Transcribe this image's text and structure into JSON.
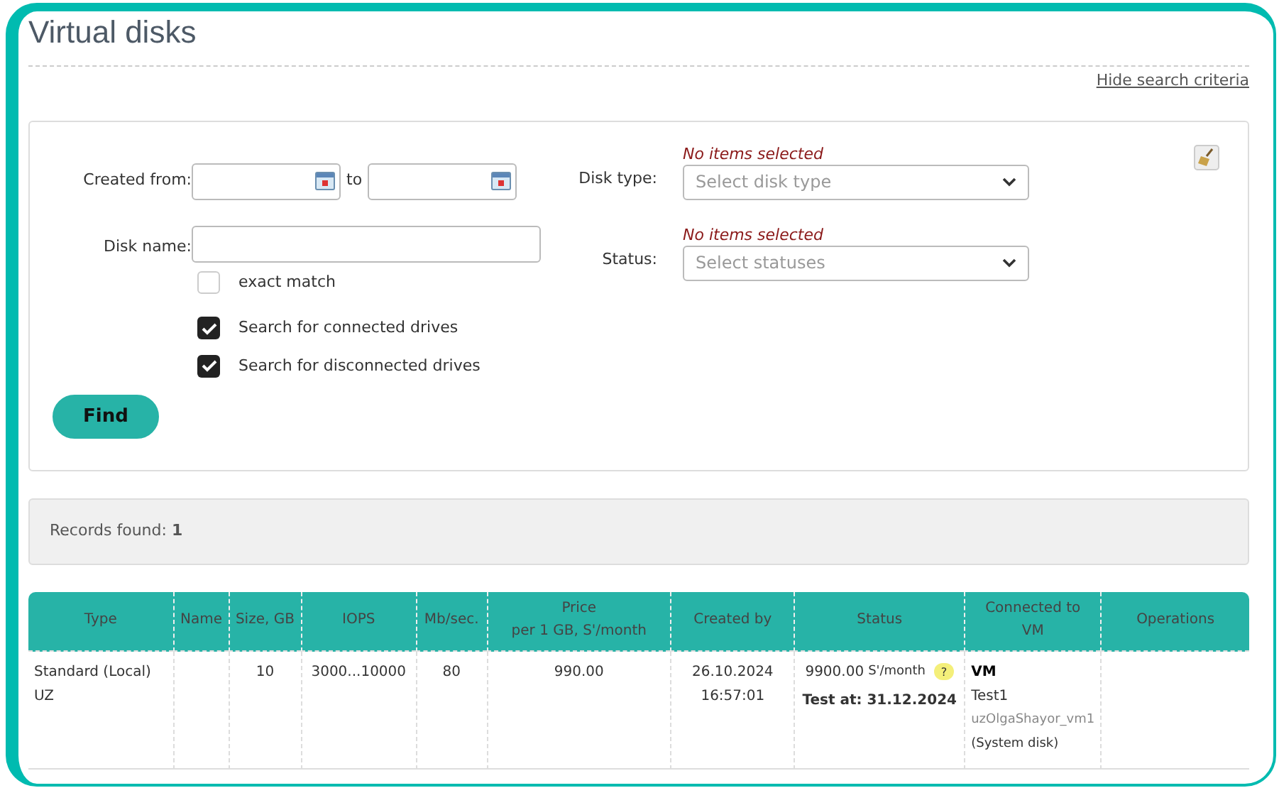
{
  "title": "Virtual disks",
  "hide_link": "Hide search criteria",
  "filters": {
    "created_from": {
      "label": "Created from:",
      "to_label": "to"
    },
    "disk_name": {
      "label": "Disk name:",
      "exact_match": {
        "label": "exact match",
        "checked": false
      }
    },
    "disk_type": {
      "label": "Disk type:",
      "note": "No items selected",
      "placeholder": "Select disk type"
    },
    "status": {
      "label": "Status:",
      "note": "No items selected",
      "placeholder": "Select statuses"
    },
    "checkboxes": [
      {
        "label": "Search for connected drives",
        "checked": true
      },
      {
        "label": "Search for disconnected drives",
        "checked": true
      }
    ],
    "find_button": "Find"
  },
  "records_found": "Records found: **1**",
  "table": {
    "columns": [
      [
        "Type"
      ],
      [
        "Name"
      ],
      [
        "Size, GB"
      ],
      [
        "IOPS"
      ],
      [
        "Mb/sec."
      ],
      [
        "Price",
        "per 1 GB, S'/month"
      ],
      [
        "Created by"
      ],
      [
        "Status"
      ],
      [
        "Connected to",
        "VM"
      ],
      [
        "Operations"
      ]
    ],
    "rows": [
      {
        "type": [
          "Standard (Local)",
          "UZ"
        ],
        "size": "10",
        "iops": "3000...10000",
        "mbps": "80",
        "price": "990.00",
        "created_by": [
          "26.10.2024",
          "16:57:01"
        ],
        "status": {
          "amount": "9900.00",
          "unit": "S'/month",
          "help": "?",
          "test_at": "Test at: 31.12.2024"
        },
        "connected": {
          "kind": "VM",
          "name": "Test1",
          "vm_id": "uzOlgaShayor_vm1",
          "note": "(System disk)"
        }
      }
    ]
  }
}
